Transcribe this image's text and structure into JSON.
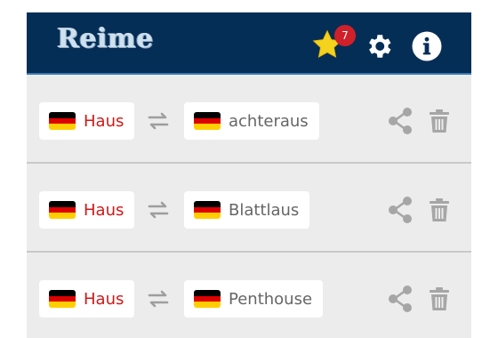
{
  "app": {
    "title": "Reime"
  },
  "header": {
    "favorites_count": "7",
    "icons": [
      "star-icon",
      "gear-icon",
      "info-icon"
    ]
  },
  "colors": {
    "header_bg": "#052e57",
    "badge": "#d0202a",
    "star": "#f5d21e",
    "source_word": "#d01818",
    "target_word": "#666666",
    "flag": [
      "#000000",
      "#dd0000",
      "#ffce00"
    ]
  },
  "rows": [
    {
      "source_word": "Haus",
      "target_word": "achteraus"
    },
    {
      "source_word": "Haus",
      "target_word": "Blattlaus"
    },
    {
      "source_word": "Haus",
      "target_word": "Penthouse"
    }
  ]
}
